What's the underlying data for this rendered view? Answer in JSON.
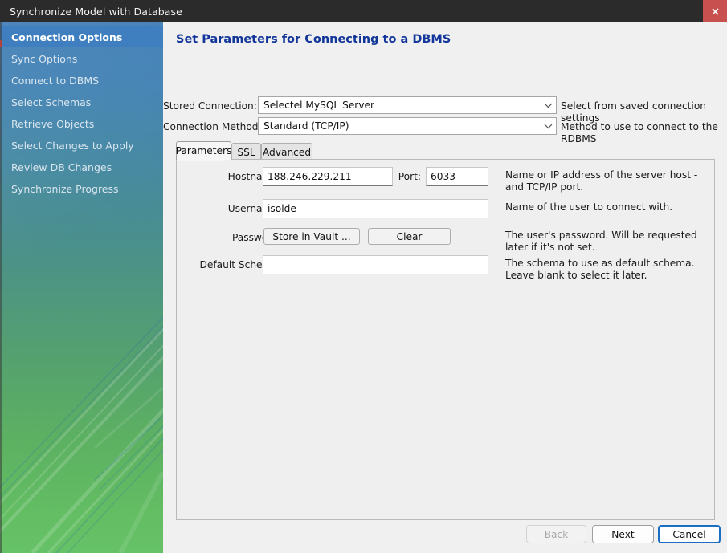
{
  "window": {
    "title": "Synchronize Model with Database",
    "close_icon": "close-icon",
    "close_glyph": "✖",
    "titlebar_color": "#2b2b2b",
    "close_button_color": "#c8504f"
  },
  "sidebar": {
    "active_index": 0,
    "gradient_from": "#3b79b4",
    "gradient_to": "#66c267",
    "active_color": "#3f7fbf",
    "items": [
      {
        "label": "Connection Options"
      },
      {
        "label": "Sync Options"
      },
      {
        "label": "Connect to DBMS"
      },
      {
        "label": "Select Schemas"
      },
      {
        "label": "Retrieve Objects"
      },
      {
        "label": "Select Changes to Apply"
      },
      {
        "label": "Review DB Changes"
      },
      {
        "label": "Synchronize Progress"
      }
    ]
  },
  "main": {
    "heading": "Set Parameters for Connecting to a DBMS",
    "heading_color": "#12369a",
    "stored_connection": {
      "label": "Stored Connection:",
      "value": "Selectel MySQL Server",
      "hint": "Select from saved connection settings",
      "arrow_icon": "chevron-down-icon"
    },
    "connection_method": {
      "label": "Connection Method:",
      "value": "Standard (TCP/IP)",
      "hint": "Method to use to connect to the RDBMS",
      "arrow_icon": "chevron-down-icon"
    },
    "tabs": [
      {
        "label": "Parameters",
        "active": true
      },
      {
        "label": "SSL",
        "active": false
      },
      {
        "label": "Advanced",
        "active": false
      }
    ],
    "parameters": {
      "hostname": {
        "label": "Hostname:",
        "value": "188.246.229.211",
        "placeholder": ""
      },
      "port": {
        "label": "Port:",
        "value": "6033",
        "placeholder": ""
      },
      "host_hint": "Name or IP address of the server host - and TCP/IP port.",
      "username": {
        "label": "Username:",
        "value": "isolde",
        "placeholder": ""
      },
      "username_hint": "Name of the user to connect with.",
      "password": {
        "label": "Password:",
        "store_button": "Store in Vault ...",
        "clear_button": "Clear"
      },
      "password_hint": "The user's password. Will be requested later if it's not set.",
      "default_schema": {
        "label": "Default Schema:",
        "value": "",
        "placeholder": ""
      },
      "default_schema_hint": "The schema to use as default schema. Leave blank to select it later."
    }
  },
  "footer": {
    "back": "Back",
    "next": "Next",
    "cancel": "Cancel",
    "back_disabled": true,
    "default_button_color": "#1a6fc4"
  }
}
